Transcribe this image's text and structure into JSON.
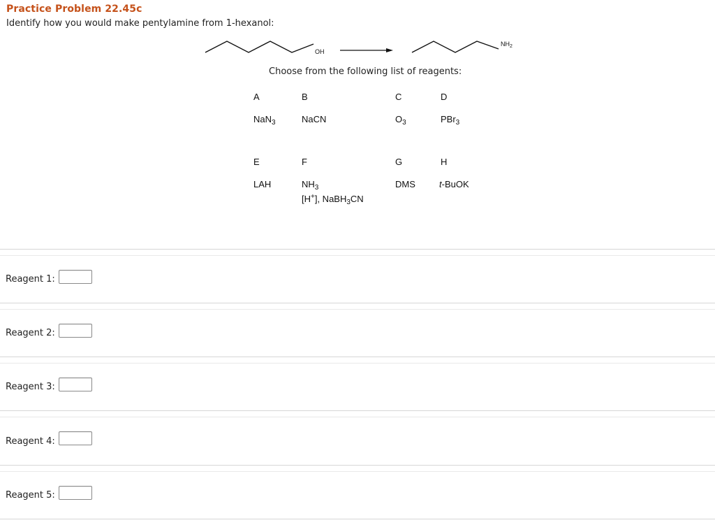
{
  "header": {
    "title": "Practice Problem 22.45c",
    "question": "Identify how you would make pentylamine from 1-hexanol:"
  },
  "scheme": {
    "reactant_label": "OH",
    "product_label": "NH",
    "product_label_sub": "2"
  },
  "reagent_list": {
    "instruction": "Choose from the following list of reagents:",
    "row1": {
      "letters": [
        "A",
        "B",
        "C",
        "D"
      ],
      "A": {
        "main": "NaN",
        "sub": "3"
      },
      "B": {
        "main": "NaCN"
      },
      "C": {
        "main": "O",
        "sub": "3"
      },
      "D": {
        "main": "PBr",
        "sub": "3"
      }
    },
    "row2": {
      "letters": [
        "E",
        "F",
        "G",
        "H"
      ],
      "E": {
        "main": "LAH"
      },
      "F": {
        "line1_main": "NH",
        "line1_sub": "3",
        "line2_a": "[H",
        "line2_sup": "+",
        "line2_b": "], NaBH",
        "line2_sub": "3",
        "line2_c": "CN"
      },
      "G": {
        "main": "DMS"
      },
      "H": {
        "italic": "t",
        "rest": "-BuOK"
      }
    }
  },
  "answers": [
    {
      "label": "Reagent 1:",
      "value": ""
    },
    {
      "label": "Reagent 2:",
      "value": ""
    },
    {
      "label": "Reagent 3:",
      "value": ""
    },
    {
      "label": "Reagent 4:",
      "value": ""
    },
    {
      "label": "Reagent 5:",
      "value": ""
    }
  ]
}
